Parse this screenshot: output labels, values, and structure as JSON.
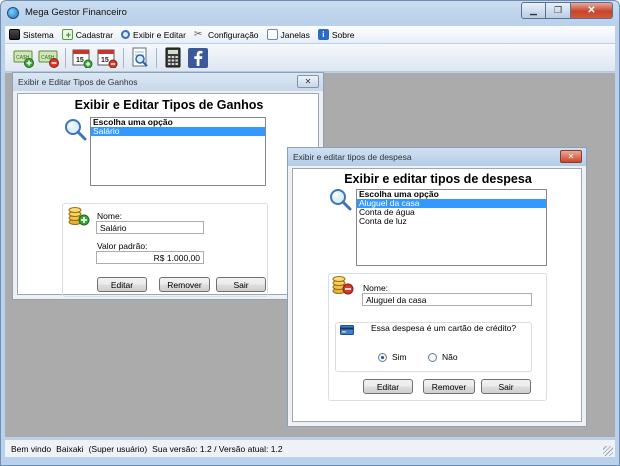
{
  "app": {
    "title": "Mega Gestor Financeiro"
  },
  "menu": [
    {
      "label": "Sistema",
      "icon": "computer-icon"
    },
    {
      "label": "Cadastrar",
      "icon": "add-icon"
    },
    {
      "label": "Exibir e Editar",
      "icon": "search-icon"
    },
    {
      "label": "Configuração",
      "icon": "tools-icon"
    },
    {
      "label": "Janelas",
      "icon": "windows-icon"
    },
    {
      "label": "Sobre",
      "icon": "info-icon"
    }
  ],
  "toolbar": {
    "money_in_label": "CA$H",
    "money_out_label": "CA$H",
    "calendar_in_label": "15",
    "calendar_out_label": "15"
  },
  "ganhos": {
    "title": "Exibir e Editar Tipos de Ganhos",
    "close": "✕",
    "heading": "Exibir e Editar Tipos de Ganhos",
    "list": [
      {
        "label": "Escolha uma opção",
        "bold": true,
        "selected": false
      },
      {
        "label": "Salário",
        "bold": false,
        "selected": true
      }
    ],
    "nome_label": "Nome:",
    "nome_value": "Salário",
    "valor_label": "Valor padrão:",
    "valor_value": "R$ 1.000,00",
    "buttons": {
      "editar": "Editar",
      "remover": "Remover",
      "sair": "Sair"
    }
  },
  "despesa": {
    "title": "Exibir e editar tipos de despesa",
    "close": "✕",
    "heading": "Exibir e editar tipos de despesa",
    "list": [
      {
        "label": "Escolha uma opção",
        "bold": true,
        "selected": false
      },
      {
        "label": "Aluguel da casa",
        "bold": false,
        "selected": true
      },
      {
        "label": "Conta de água",
        "bold": false,
        "selected": false
      },
      {
        "label": "Conta de luz",
        "bold": false,
        "selected": false
      }
    ],
    "nome_label": "Nome:",
    "nome_value": "Aluguel da casa",
    "cartao_question": "Essa despesa é um cartão de crédito?",
    "sim_label": "Sim",
    "nao_label": "Não",
    "sim_selected": true,
    "buttons": {
      "editar": "Editar",
      "remover": "Remover",
      "sair": "Sair"
    }
  },
  "status": {
    "welcome": "Bem vindo",
    "user": "Baixaki",
    "role": "(Super usuário)",
    "version": "Sua versão: 1.2 / Versão atual: 1.2"
  }
}
